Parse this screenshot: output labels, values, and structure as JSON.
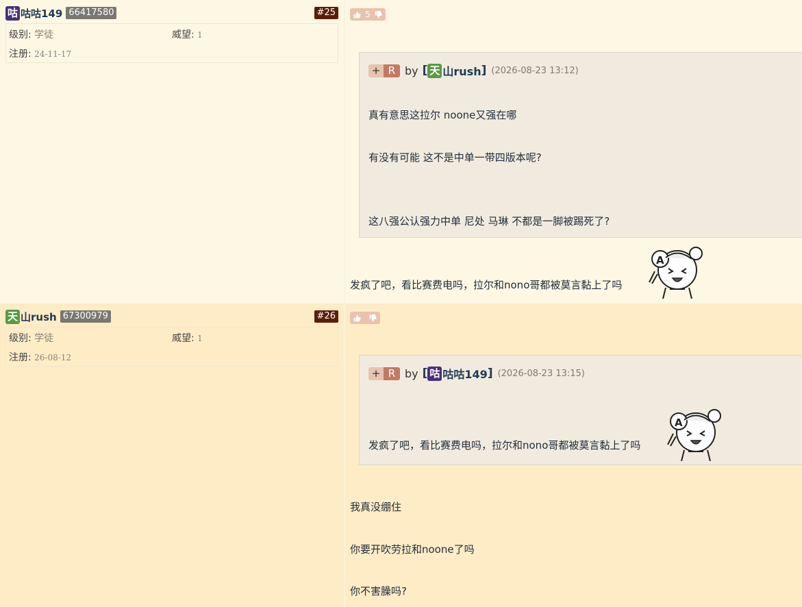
{
  "posts": [
    {
      "user": {
        "tag": "咕",
        "tag_color": "#4a2f7a",
        "name": "咕咕149",
        "uid": "66417580"
      },
      "floor": "#25",
      "info": {
        "level_label": "级别:",
        "level": "学徒",
        "prestige_label": "威望:",
        "prestige": "1",
        "reg_label": "注册:",
        "reg": "24-11-17"
      },
      "vote": {
        "count": "5"
      },
      "quote": {
        "plus": "+",
        "r": "R",
        "by": "by",
        "user_tag": "天",
        "user_tag_color": "#5a9a45",
        "user_name": "山rush",
        "time": "(2026-08-23 13:12)",
        "lines": [
          "真有意思这拉尔 noone又强在哪",
          "有没有可能 这不是中单一带四版本呢?",
          "这八强公认强力中单 尼处 马琳 不都是一脚被踢死了?"
        ]
      },
      "body": [
        "发疯了吧，看比赛费电吗，拉尔和nono哥都被莫言黏上了吗"
      ]
    },
    {
      "user": {
        "tag": "天",
        "tag_color": "#5a9a45",
        "name": "山rush",
        "uid": "67300979"
      },
      "floor": "#26",
      "info": {
        "level_label": "级别:",
        "level": "学徒",
        "prestige_label": "威望:",
        "prestige": "1",
        "reg_label": "注册:",
        "reg": "26-08-12"
      },
      "vote": {
        "count": ""
      },
      "quote": {
        "plus": "+",
        "r": "R",
        "by": "by",
        "user_tag": "咕",
        "user_tag_color": "#4a2f7a",
        "user_name": "咕咕149",
        "time": "(2026-08-23 13:15)",
        "lines": [
          "发疯了吧，看比赛费电吗，拉尔和nono哥都被莫言黏上了吗"
        ]
      },
      "body": [
        "我真没绷住",
        "你要开吹劳拉和noone了吗",
        "你不害臊吗?"
      ]
    }
  ],
  "icons": {
    "like": "thumbs-up-icon",
    "dislike": "thumbs-down-icon",
    "sticker": "anime-girl-laughing-sticker"
  }
}
